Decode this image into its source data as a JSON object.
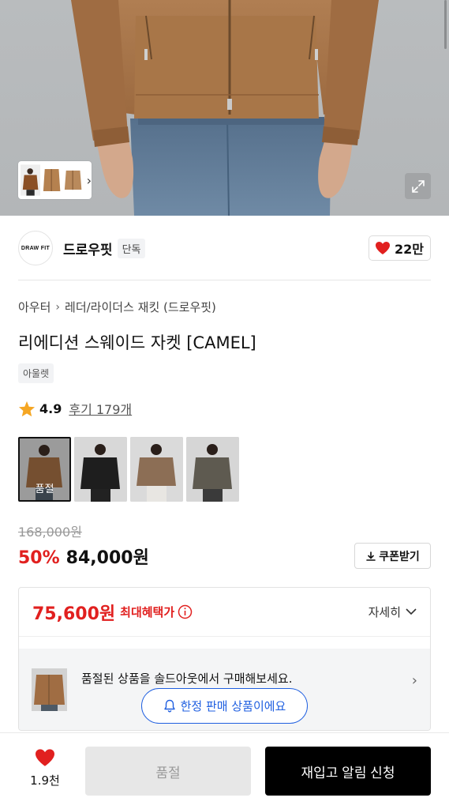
{
  "brand": {
    "logo_text": "DRAW FIT",
    "name": "드로우핏",
    "badge": "단독"
  },
  "like": {
    "count": "22만",
    "bottom_count": "1.9천",
    "color": "#e1201f"
  },
  "breadcrumb": {
    "parent": "아우터",
    "child": "레더/라이더스 재킷 (드로우핏)"
  },
  "product": {
    "title": "리에디션 스웨이드 자켓 [CAMEL]",
    "tag": "아울렛",
    "rating": "4.9",
    "review_label": "후기 179개"
  },
  "color_options": [
    {
      "name": "camel",
      "selected": true,
      "label": "품절"
    },
    {
      "name": "black",
      "selected": false,
      "label": ""
    },
    {
      "name": "taupe",
      "selected": false,
      "label": ""
    },
    {
      "name": "khaki",
      "selected": false,
      "label": ""
    }
  ],
  "price": {
    "original": "168,000원",
    "discount": "50%",
    "sale": "84,000원",
    "coupon_label": "쿠폰받기"
  },
  "benefit": {
    "max_price": "75,600원",
    "max_label": "최대혜택가",
    "detail_label": "자세히"
  },
  "soldout_banner": {
    "message": "품절된 상품을 솔드아웃에서 구매해보세요.",
    "limited_label": "한정 판매 상품이에요"
  },
  "actions": {
    "soldout_label": "품절",
    "restock_label": "재입고 알림 신청"
  },
  "colors": {
    "accent_red": "#e1201f",
    "accent_blue": "#1f5fe0",
    "camel": "#a9794c"
  },
  "icons": [
    "expand-icon",
    "chevron-right-icon",
    "heart-icon",
    "star-icon",
    "download-icon",
    "info-icon",
    "chevron-down-icon",
    "bell-icon"
  ]
}
